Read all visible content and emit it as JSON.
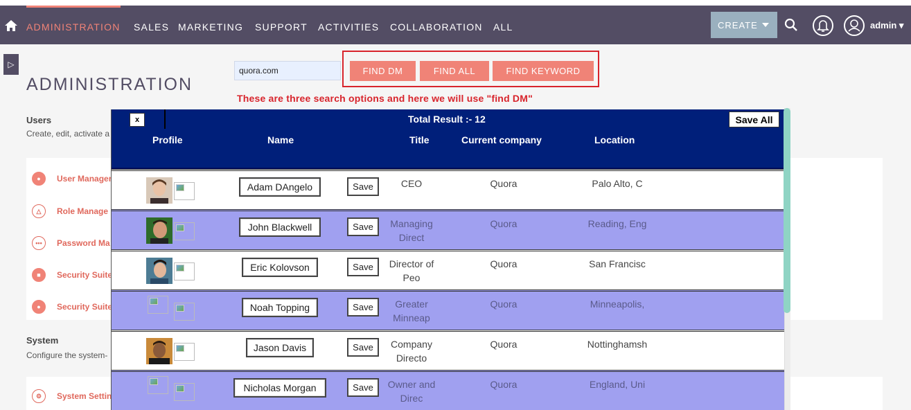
{
  "nav": {
    "items": [
      "ADMINISTRATION",
      "SALES",
      "MARKETING",
      "SUPPORT",
      "ACTIVITIES",
      "COLLABORATION",
      "ALL"
    ],
    "create_label": "CREATE",
    "user_name": "admin"
  },
  "page": {
    "title": "ADMINISTRATION",
    "users_heading": "Users",
    "users_desc": "Create, edit, activate a",
    "system_heading": "System",
    "system_desc": "Configure the system-",
    "admin_links": [
      "User Manager",
      "Role Manage",
      "Password Ma",
      "Security Suite",
      "Security Suite"
    ],
    "system_links": [
      "System Settin"
    ]
  },
  "search": {
    "domain_value": "quora.com",
    "find_dm_label": "FIND DM",
    "find_all_label": "FIND ALL",
    "find_keyword_label": "FIND KEYWORD",
    "annotation": "These are three search options and here we will use \"find DM\""
  },
  "results": {
    "close_label": "x",
    "total": "Total Result :- 12",
    "save_all_label": "Save All",
    "columns": [
      "Profile",
      "Name",
      "Title",
      "Current company",
      "Location"
    ],
    "save_label": "Save",
    "rows": [
      {
        "name": "Adam DAngelo",
        "title": "CEO",
        "company": "Quora",
        "location": "Palo Alto, C"
      },
      {
        "name": "John Blackwell",
        "title": "Managing Direct",
        "company": "Quora",
        "location": "Reading, Eng"
      },
      {
        "name": "Eric Kolovson",
        "title": "Director of Peo",
        "company": "Quora",
        "location": "San Francisc"
      },
      {
        "name": "Noah Topping",
        "title": "Greater Minneap",
        "company": "Quora",
        "location": "Minneapolis,"
      },
      {
        "name": "Jason Davis",
        "title": "Company Directo",
        "company": "Quora",
        "location": "Nottinghamsh"
      },
      {
        "name": "Nicholas Morgan",
        "title": "Owner and Direc",
        "company": "Quora",
        "location": "England, Uni"
      }
    ]
  },
  "colors": {
    "nav_bg": "#534d64",
    "accent": "#f08377",
    "header_blue": "#001f7a",
    "row_alt": "#a0a0f0",
    "annotation_red": "#d8242c"
  }
}
